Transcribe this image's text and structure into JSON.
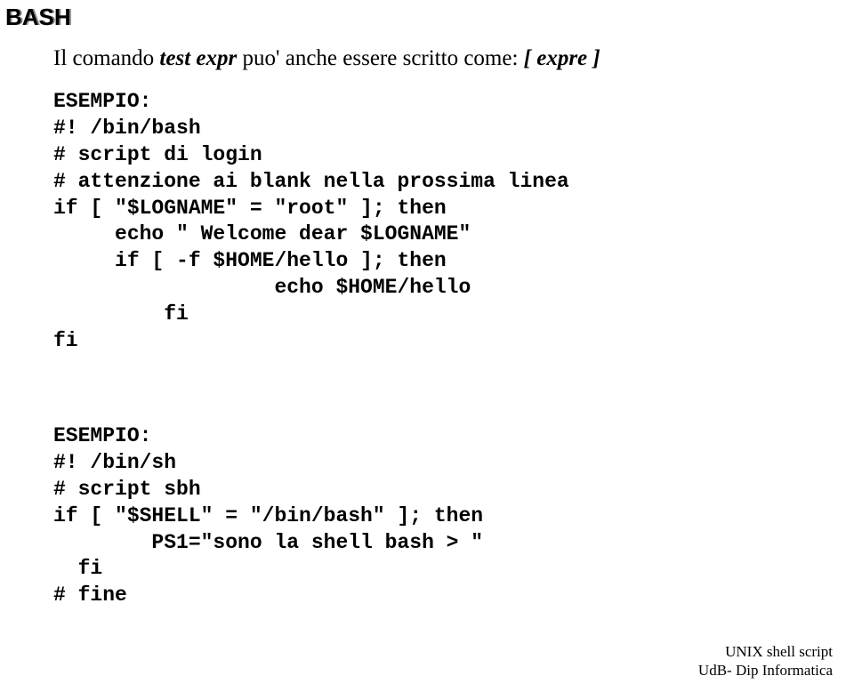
{
  "heading": "BASH",
  "intro": {
    "pre": "Il comando  ",
    "testexpr": "test expr",
    "mid": "  puo' anche essere scritto come:   ",
    "brackets": "[ expre ]"
  },
  "code1": "ESEMPIO:\n#! /bin/bash\n# script di login\n# attenzione ai blank nella prossima linea\nif [ \"$LOGNAME\" = \"root\" ]; then\n     echo \" Welcome dear $LOGNAME\"\n     if [ -f $HOME/hello ]; then\n                  echo $HOME/hello\n         fi\nfi",
  "code2": "ESEMPIO:\n#! /bin/sh\n# script sbh\nif [ \"$SHELL\" = \"/bin/bash\" ]; then\n        PS1=\"sono la shell bash > \"\n  fi\n# fine",
  "footer": {
    "line1": "UNIX shell script",
    "line2": "UdB- Dip Informatica"
  }
}
